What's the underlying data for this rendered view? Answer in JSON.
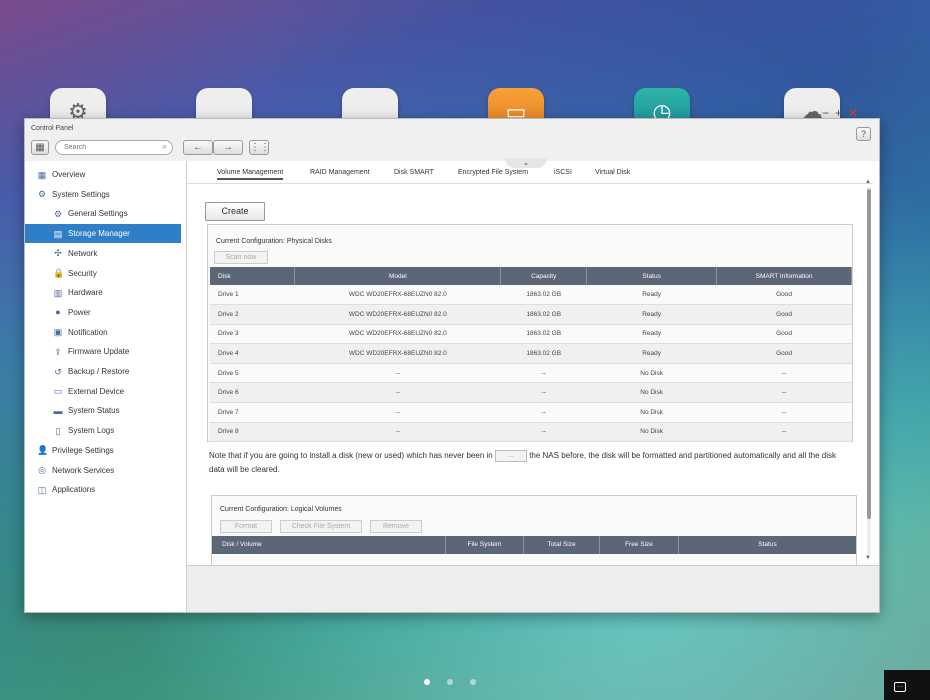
{
  "window": {
    "title": "Control Panel"
  },
  "search": {
    "placeholder": "Search"
  },
  "help_label": "?",
  "sidebar": {
    "items": [
      {
        "label": "Overview",
        "icon": "overview-icon"
      },
      {
        "label": "System Settings",
        "icon": "gear-icon"
      },
      {
        "label": "General Settings",
        "icon": "settings-icon"
      },
      {
        "label": "Storage Manager",
        "icon": "storage-icon",
        "active": true
      },
      {
        "label": "Network",
        "icon": "network-icon"
      },
      {
        "label": "Security",
        "icon": "lock-icon"
      },
      {
        "label": "Hardware",
        "icon": "hardware-icon"
      },
      {
        "label": "Power",
        "icon": "power-icon"
      },
      {
        "label": "Notification",
        "icon": "notification-icon"
      },
      {
        "label": "Firmware Update",
        "icon": "firmware-icon"
      },
      {
        "label": "Backup / Restore",
        "icon": "backup-icon"
      },
      {
        "label": "External Device",
        "icon": "external-device-icon"
      },
      {
        "label": "System Status",
        "icon": "system-status-icon"
      },
      {
        "label": "System Logs",
        "icon": "logs-icon"
      },
      {
        "label": "Privilege Settings",
        "icon": "user-icon"
      },
      {
        "label": "Network Services",
        "icon": "globe-icon"
      },
      {
        "label": "Applications",
        "icon": "applications-icon"
      }
    ]
  },
  "tabs": [
    "Volume Management",
    "RAID Management",
    "Disk SMART",
    "Encrypted File System",
    "iSCSI",
    "Virtual Disk"
  ],
  "create_label": "Create",
  "physical": {
    "title": "Current Configuration: Physical Disks",
    "scan_label": "Scan now",
    "columns": [
      "Disk",
      "Model",
      "Capacity",
      "Status",
      "SMART Information"
    ],
    "rows": [
      [
        "Drive 1",
        "WDC WD20EFRX-68EUZN0 82.0",
        "1863.02 GB",
        "Ready",
        "Good"
      ],
      [
        "Drive 2",
        "WDC WD20EFRX-68EUZN0 82.0",
        "1863.02 GB",
        "Ready",
        "Good"
      ],
      [
        "Drive 3",
        "WDC WD20EFRX-68EUZN0 82.0",
        "1863.02 GB",
        "Ready",
        "Good"
      ],
      [
        "Drive 4",
        "WDC WD20EFRX-68EUZN0 82.0",
        "1863.02 GB",
        "Ready",
        "Good"
      ],
      [
        "Drive 5",
        "--",
        "--",
        "No Disk",
        "--"
      ],
      [
        "Drive 6",
        "--",
        "--",
        "No Disk",
        "--"
      ],
      [
        "Drive 7",
        "--",
        "--",
        "No Disk",
        "--"
      ],
      [
        "Drive 8",
        "--",
        "--",
        "No Disk",
        "--"
      ]
    ]
  },
  "note": {
    "before": "Note that if you are going to install a disk (new or used) which has never been in",
    "box": "...",
    "after": "the NAS before, the disk will be formatted and partitioned automatically and all the disk data will be cleared."
  },
  "logical": {
    "title": "Current Configuration: Logical Volumes",
    "buttons": [
      "Format",
      "Check File System",
      "Remove"
    ],
    "columns": [
      "Disk / Volume",
      "File System",
      "Total Size",
      "Free Size",
      "Status"
    ]
  },
  "colors": {
    "accent": "#2f7ec8",
    "table_header": "#5b6677",
    "good": "#3a8a2a",
    "close": "#d23a3a"
  }
}
